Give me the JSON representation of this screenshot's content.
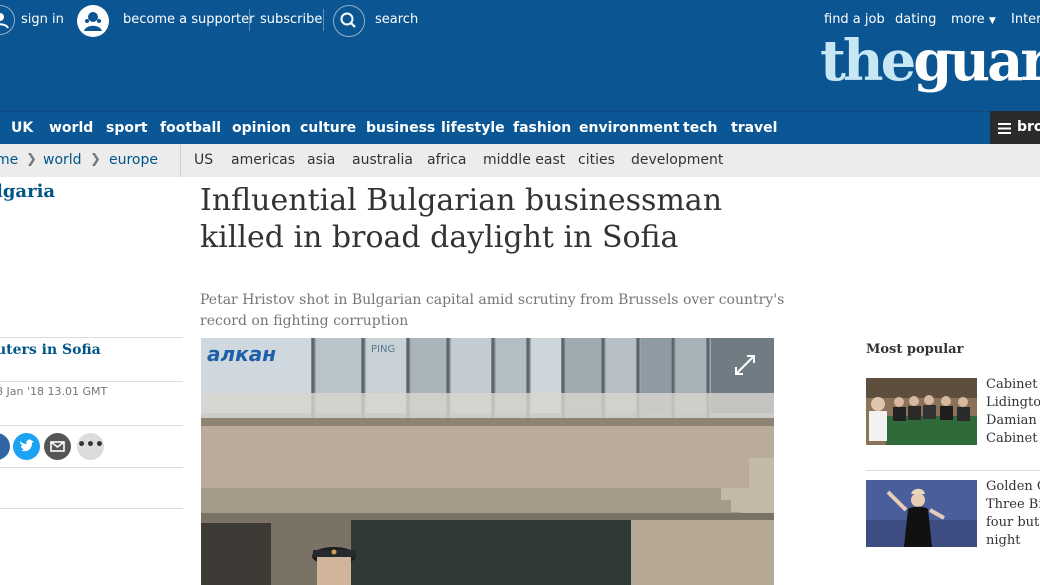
{
  "header": {
    "sign_in": "sign in",
    "become_supporter": "become a supporter",
    "subscribe": "subscribe",
    "search": "search",
    "find_a_job": "find a job",
    "dating": "dating",
    "more": "more",
    "edition": "Intern",
    "logo_the": "the",
    "logo_rest": "guard"
  },
  "nav": {
    "items": [
      "UK",
      "world",
      "sport",
      "football",
      "opinion",
      "culture",
      "business",
      "lifestyle",
      "fashion",
      "environment",
      "tech",
      "travel"
    ],
    "menu_label": "bro"
  },
  "subnav": {
    "breadcrumbs": [
      "me",
      "world",
      "europe"
    ],
    "items": [
      "US",
      "americas",
      "asia",
      "australia",
      "africa",
      "middle east",
      "cities",
      "development"
    ]
  },
  "article": {
    "section_tag": "lgaria",
    "headline": "Influential Bulgarian businessman killed in broad daylight in Sofia",
    "standfirst": "Petar Hristov shot in Bulgarian capital amid scrutiny from Brussels over country's record on fighting corruption",
    "byline": "uters in Sofia",
    "dateline": "8 Jan '18 13.01 GMT",
    "photo_sign_text": "алкан",
    "photo_sign2_text": "PING"
  },
  "most_popular": {
    "title": "Most popular",
    "items": [
      {
        "lines": [
          "Cabinet r",
          "Lidingto",
          "Damian G",
          "Cabinet c"
        ]
      },
      {
        "lines": [
          "Golden G",
          "Three Bil",
          "four but",
          "night"
        ]
      }
    ]
  },
  "colors": {
    "header_blue": "#0a5592",
    "nav_blue": "#0b5796",
    "link_blue": "#005689",
    "twitter": "#1da1f2",
    "facebook": "#3067a3"
  }
}
